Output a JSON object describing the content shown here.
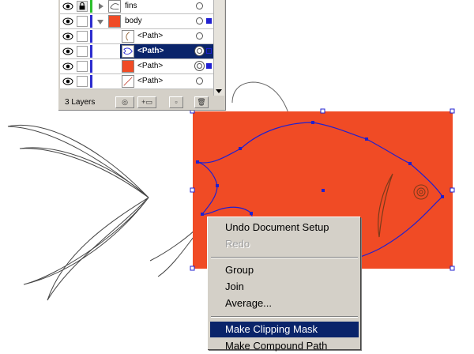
{
  "layers_panel": {
    "rows": [
      {
        "name": "fins",
        "kind": "group",
        "visible": true,
        "locked": true
      },
      {
        "name": "body",
        "kind": "group",
        "visible": true,
        "locked": false
      },
      {
        "name": "<Path>",
        "kind": "path",
        "thumb": "fin-curve"
      },
      {
        "name": "<Path>",
        "kind": "path",
        "thumb": "fish-outline",
        "selected": true
      },
      {
        "name": "<Path>",
        "kind": "path",
        "thumb": "orange-rect"
      },
      {
        "name": "<Path>",
        "kind": "path",
        "thumb": "diagonal-line"
      }
    ],
    "footer": {
      "layer_count": "3 Layers"
    }
  },
  "canvas": {
    "fill_color": "#f04b25",
    "selection_color": "#2020d0"
  },
  "context_menu": {
    "items": [
      {
        "label": "Undo Document Setup",
        "enabled": true
      },
      {
        "label": "Redo",
        "enabled": false
      },
      {
        "label": "Group",
        "enabled": true
      },
      {
        "label": "Join",
        "enabled": true
      },
      {
        "label": "Average...",
        "enabled": true
      },
      {
        "label": "Make Clipping Mask",
        "enabled": true,
        "highlighted": true
      },
      {
        "label": "Make Compound Path",
        "enabled": true
      }
    ]
  },
  "colors": {
    "panel_bg": "#d4d0c8",
    "selection_highlight": "#0a246a",
    "layer_color": "#2c2ccf",
    "fish_fill": "#f04b25"
  }
}
